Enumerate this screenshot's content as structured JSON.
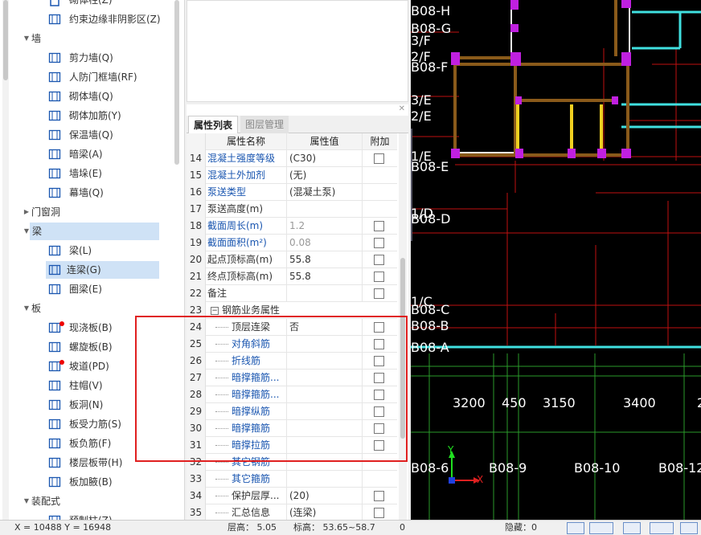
{
  "tree": {
    "top_partial": "砌体柱(Z)",
    "items": [
      {
        "type": "item",
        "label": "约束边缘非阴影区(Z)",
        "icon": "constraint-edge-icon"
      },
      {
        "type": "cat",
        "label": "墙",
        "expanded": true
      },
      {
        "type": "item",
        "label": "剪力墙(Q)",
        "icon": "shear-wall-icon"
      },
      {
        "type": "item",
        "label": "人防门框墙(RF)",
        "icon": "civil-defense-door-wall-icon"
      },
      {
        "type": "item",
        "label": "砌体墙(Q)",
        "icon": "masonry-wall-icon"
      },
      {
        "type": "item",
        "label": "砌体加筋(Y)",
        "icon": "masonry-rebar-icon"
      },
      {
        "type": "item",
        "label": "保温墙(Q)",
        "icon": "insulation-wall-icon"
      },
      {
        "type": "item",
        "label": "暗梁(A)",
        "icon": "hidden-beam-icon"
      },
      {
        "type": "item",
        "label": "墙垛(E)",
        "icon": "wall-pier-icon"
      },
      {
        "type": "item",
        "label": "幕墙(Q)",
        "icon": "curtain-wall-icon"
      },
      {
        "type": "cat",
        "label": "门窗洞",
        "expanded": false
      },
      {
        "type": "cat",
        "label": "梁",
        "expanded": true,
        "selected": true
      },
      {
        "type": "item",
        "label": "梁(L)",
        "icon": "beam-icon"
      },
      {
        "type": "item",
        "label": "连梁(G)",
        "icon": "coupling-beam-icon",
        "selected": true
      },
      {
        "type": "item",
        "label": "圈梁(E)",
        "icon": "ring-beam-icon"
      },
      {
        "type": "cat",
        "label": "板",
        "expanded": true
      },
      {
        "type": "item",
        "label": "现浇板(B)",
        "icon": "cast-slab-icon",
        "dot": true
      },
      {
        "type": "item",
        "label": "螺旋板(B)",
        "icon": "spiral-slab-icon"
      },
      {
        "type": "item",
        "label": "坡道(PD)",
        "icon": "ramp-icon",
        "dot": true
      },
      {
        "type": "item",
        "label": "柱帽(V)",
        "icon": "column-cap-icon"
      },
      {
        "type": "item",
        "label": "板洞(N)",
        "icon": "slab-hole-icon"
      },
      {
        "type": "item",
        "label": "板受力筋(S)",
        "icon": "slab-main-rebar-icon"
      },
      {
        "type": "item",
        "label": "板负筋(F)",
        "icon": "slab-negative-rebar-icon"
      },
      {
        "type": "item",
        "label": "楼层板带(H)",
        "icon": "floor-slab-strip-icon"
      },
      {
        "type": "item",
        "label": "板加腋(B)",
        "icon": "slab-haunch-icon"
      },
      {
        "type": "cat",
        "label": "装配式",
        "expanded": true
      },
      {
        "type": "item",
        "label": "预制柱(Z)",
        "icon": "precast-column-icon"
      }
    ]
  },
  "props": {
    "tabs": [
      "属性列表",
      "图层管理"
    ],
    "headers": [
      "属性名称",
      "属性值",
      "附加"
    ],
    "rows": [
      {
        "n": "14",
        "name": "混凝土强度等级",
        "val": "(C30)",
        "blue": true,
        "cb": true
      },
      {
        "n": "15",
        "name": "混凝土外加剂",
        "val": "(无)",
        "blue": true,
        "cb": false
      },
      {
        "n": "16",
        "name": "泵送类型",
        "val": "(混凝土泵)",
        "blue": true,
        "cb": false
      },
      {
        "n": "17",
        "name": "泵送高度(m)",
        "val": "",
        "blue": false,
        "cb": false
      },
      {
        "n": "18",
        "name": "截面周长(m)",
        "val": "1.2",
        "blue": true,
        "cb": true,
        "grayval": true
      },
      {
        "n": "19",
        "name": "截面面积(m²)",
        "val": "0.08",
        "blue": true,
        "cb": true,
        "grayval": true
      },
      {
        "n": "20",
        "name": "起点顶标高(m)",
        "val": "55.8",
        "blue": false,
        "cb": true
      },
      {
        "n": "21",
        "name": "终点顶标高(m)",
        "val": "55.8",
        "blue": false,
        "cb": true
      },
      {
        "n": "22",
        "name": "备注",
        "val": "",
        "blue": false,
        "cb": true
      },
      {
        "n": "23",
        "name": "钢筋业务属性",
        "val": "",
        "blue": false,
        "cb": false,
        "group": true
      },
      {
        "n": "24",
        "name": "顶层连梁",
        "val": "否",
        "blue": false,
        "cb": true,
        "sub": true
      },
      {
        "n": "25",
        "name": "对角斜筋",
        "val": "",
        "blue": true,
        "cb": true,
        "sub": true
      },
      {
        "n": "26",
        "name": "折线筋",
        "val": "",
        "blue": true,
        "cb": true,
        "sub": true
      },
      {
        "n": "27",
        "name": "暗撑箍筋...",
        "val": "",
        "blue": true,
        "cb": true,
        "sub": true
      },
      {
        "n": "28",
        "name": "暗撑箍筋...",
        "val": "",
        "blue": true,
        "cb": true,
        "sub": true
      },
      {
        "n": "29",
        "name": "暗撑纵筋",
        "val": "",
        "blue": true,
        "cb": true,
        "sub": true
      },
      {
        "n": "30",
        "name": "暗撑箍筋",
        "val": "",
        "blue": true,
        "cb": true,
        "sub": true
      },
      {
        "n": "31",
        "name": "暗撑拉筋",
        "val": "",
        "blue": true,
        "cb": true,
        "sub": true
      },
      {
        "n": "32",
        "name": "其它钢筋",
        "val": "",
        "blue": true,
        "cb": false,
        "sub": true
      },
      {
        "n": "33",
        "name": "其它箍筋",
        "val": "",
        "blue": true,
        "cb": false,
        "sub": true
      },
      {
        "n": "34",
        "name": "保护层厚...",
        "val": "(20)",
        "blue": false,
        "cb": true,
        "sub": true
      },
      {
        "n": "35",
        "name": "汇总信息",
        "val": "(连梁)",
        "blue": false,
        "cb": true,
        "sub": true
      }
    ]
  },
  "cad": {
    "axis_labels": [
      "B08-H",
      "B08-G",
      "3/F",
      "2/F",
      "B08-F",
      "3/E",
      "2/E",
      "1/E",
      "B08-E",
      "1/D",
      "B08-D",
      "1/C",
      "B08-C",
      "B08-B",
      "B08-A"
    ],
    "dims": [
      "3200",
      "450",
      "3150",
      "3400",
      "2"
    ],
    "bottom_axes": [
      "B08-6",
      "B08-9",
      "B08-10",
      "B08-12"
    ],
    "axis_y": "Y",
    "axis_x": "X"
  },
  "status": {
    "coords": "X = 10488 Y = 16948",
    "floor_height": "层高：  5.05",
    "elevation": "标高：  53.65~58.7",
    "zero": "0",
    "hidden": "隐藏：0"
  }
}
